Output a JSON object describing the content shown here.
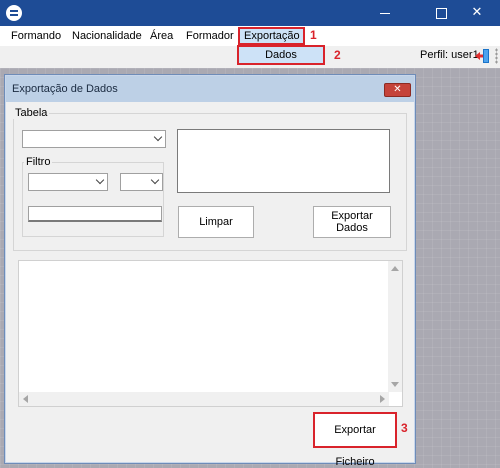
{
  "titlebar": {
    "close_glyph": "✕"
  },
  "menu": {
    "items": [
      {
        "label": "Formando"
      },
      {
        "label": "Nacionalidade"
      },
      {
        "label": "Área"
      },
      {
        "label": "Formador"
      },
      {
        "label": "Exportação"
      }
    ],
    "dropdown_item": "Dados"
  },
  "annotations": {
    "step1": "1",
    "step2": "2",
    "step3": "3"
  },
  "toolbar": {
    "profile_label": "Perfil: user1"
  },
  "child_window": {
    "title": "Exportação de Dados",
    "close_glyph": "✕",
    "table_group": {
      "legend": "Tabela",
      "table_combo_value": ""
    },
    "filter_group": {
      "legend": "Filtro",
      "field_combo_value": "",
      "operator_combo_value": "",
      "filter_value": ""
    },
    "buttons": {
      "clear": "Limpar",
      "export_data": "Exportar Dados",
      "export_file": "Exportar Ficheiro"
    }
  },
  "colors": {
    "titlebar": "#1e4c96",
    "highlight_border": "#d9232b",
    "menu_highlight": "#cde2f7"
  }
}
